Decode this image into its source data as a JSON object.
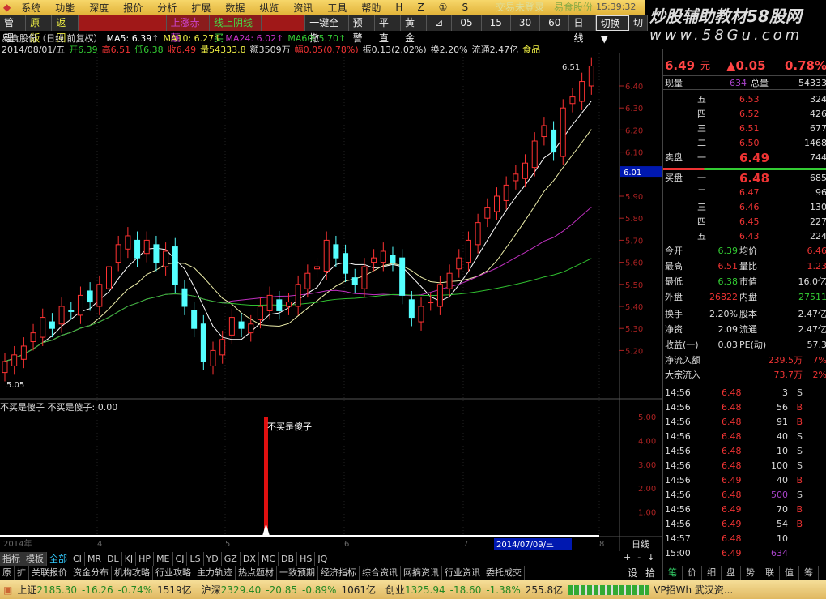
{
  "menu": [
    "系统",
    "功能",
    "深度",
    "报价",
    "分析",
    "扩展",
    "数据",
    "纵览",
    "资讯",
    "工具",
    "帮助",
    "H",
    "Z",
    "①",
    "S"
  ],
  "menu_right": {
    "trade": "交易未登录",
    "stock": "易食股份",
    "time": "15:39:32"
  },
  "watermark": {
    "line1": "炒股辅助教材58股网",
    "line2": "www.58Gu.com"
  },
  "toolbar": {
    "left": [
      "管理",
      "原版",
      "返回"
    ],
    "banners": [
      "上涨赤蘸",
      "线上阴线买"
    ],
    "right": [
      "一键全撤",
      "预警",
      "平直",
      "黄金",
      "⊿",
      "05",
      "15",
      "30",
      "60",
      "日线",
      "切换▼",
      "切"
    ]
  },
  "info1": {
    "title": "易食股份（日线 前复权）",
    "ma5": "MA5: 6.39↑",
    "ma10": "MA10: 6.27↑",
    "ma24": "MA24: 6.02↑",
    "ma60": "MA60: 5.70↑"
  },
  "info2": {
    "date": "2014/08/01/五",
    "open": "开6.39",
    "high": "高6.51",
    "low": "低6.38",
    "close": "收6.49",
    "vol": "量54333.8",
    "amt": "额3509万",
    "chg": "幅0.05(0.78%)",
    "amp": "振0.13(2.02%)",
    "turn": "换2.20%",
    "float": "流通2.47亿",
    "sector": "食品"
  },
  "chart_data": {
    "type": "candlestick",
    "ylim": [
      5.05,
      6.55
    ],
    "yticks": [
      "6.40",
      "6.30",
      "6.20",
      "6.10",
      "5.90",
      "5.80",
      "5.70",
      "5.60",
      "5.50",
      "5.40",
      "5.30",
      "5.20"
    ],
    "cursor_price": "6.01",
    "high_label": "6.51",
    "low_label": "5.05",
    "closes": [
      5.15,
      5.18,
      5.22,
      5.28,
      5.35,
      5.3,
      5.4,
      5.38,
      5.45,
      5.42,
      5.5,
      5.58,
      5.68,
      5.72,
      5.62,
      5.7,
      5.6,
      5.65,
      5.5,
      5.4,
      5.3,
      5.15,
      5.2,
      5.25,
      5.35,
      5.3,
      5.32,
      5.4,
      5.45,
      5.38,
      5.42,
      5.5,
      5.55,
      5.58,
      5.7,
      5.62,
      5.55,
      5.5,
      5.58,
      5.62,
      5.65,
      5.6,
      5.45,
      5.35,
      5.4,
      5.42,
      5.5,
      5.55,
      5.62,
      5.7,
      5.78,
      5.85,
      5.9,
      5.95,
      6.0,
      6.05,
      6.15,
      6.22,
      6.1,
      6.3,
      6.35,
      6.42,
      6.49
    ],
    "x_labels": [
      "2014年",
      "4",
      "5",
      "6",
      "7",
      "8"
    ],
    "cursor_date": "2014/07/09/三"
  },
  "indicator": {
    "name": "不买是傻子",
    "value_label": "不买是傻子: 0.00",
    "signal_label": "不买是傻子",
    "yticks": [
      "5.00",
      "4.00",
      "3.00",
      "2.00",
      "1.00"
    ],
    "ylim": [
      0,
      5
    ],
    "signal_value": 5
  },
  "period": "日线",
  "zoom_btns": [
    "+",
    "-",
    "↓"
  ],
  "quote": {
    "price": "6.49",
    "unit": "元",
    "change": "▲0.05",
    "pct": "0.78%",
    "xl_label": "现量",
    "xl": "634",
    "zl_label": "总量",
    "zl": "54333",
    "asks": [
      {
        "l": "五",
        "p": "6.53",
        "v": "324"
      },
      {
        "l": "四",
        "p": "6.52",
        "v": "426"
      },
      {
        "l": "三",
        "p": "6.51",
        "v": "677"
      },
      {
        "l": "二",
        "p": "6.50",
        "v": "1468"
      },
      {
        "l": "一",
        "p": "6.49",
        "v": "744"
      }
    ],
    "bids": [
      {
        "l": "一",
        "p": "6.48",
        "v": "685"
      },
      {
        "l": "二",
        "p": "6.47",
        "v": "96"
      },
      {
        "l": "三",
        "p": "6.46",
        "v": "130"
      },
      {
        "l": "四",
        "p": "6.45",
        "v": "227"
      },
      {
        "l": "五",
        "p": "6.43",
        "v": "224"
      }
    ],
    "sell_label": "卖盘",
    "buy_label": "买盘",
    "stats": [
      [
        "今开",
        "6.39",
        "均价",
        "6.46"
      ],
      [
        "最高",
        "6.51",
        "量比",
        "1.23"
      ],
      [
        "最低",
        "6.38",
        "市值",
        "16.0亿"
      ],
      [
        "外盘",
        "26822",
        "内盘",
        "27511"
      ],
      [
        "换手",
        "2.20%",
        "股本",
        "2.47亿"
      ],
      [
        "净资",
        "2.09",
        "流通",
        "2.47亿"
      ],
      [
        "收益(一)",
        "0.03",
        "PE(动)",
        "57.3"
      ]
    ],
    "flow": [
      [
        "净流入额",
        "239.5万",
        "7%"
      ],
      [
        "大宗流入",
        "73.7万",
        "2%"
      ]
    ],
    "ticks": [
      [
        "14:56",
        "6.48",
        "3",
        "S"
      ],
      [
        "14:56",
        "6.48",
        "56",
        "B"
      ],
      [
        "14:56",
        "6.48",
        "91",
        "B"
      ],
      [
        "14:56",
        "6.48",
        "40",
        "S"
      ],
      [
        "14:56",
        "6.48",
        "10",
        "S"
      ],
      [
        "14:56",
        "6.48",
        "100",
        "S"
      ],
      [
        "14:56",
        "6.49",
        "40",
        "B"
      ],
      [
        "14:56",
        "6.48",
        "500",
        "S"
      ],
      [
        "14:56",
        "6.49",
        "70",
        "B"
      ],
      [
        "14:56",
        "6.49",
        "54",
        "B"
      ],
      [
        "14:57",
        "6.48",
        "10",
        ""
      ],
      [
        "15:00",
        "6.49",
        "634",
        ""
      ]
    ],
    "bottom_tabs": [
      "笔",
      "价",
      "细",
      "盘",
      "势",
      "联",
      "值",
      "筹"
    ]
  },
  "tabs1": [
    "指标",
    "模板",
    "全部",
    "CI",
    "MR",
    "DL",
    "KJ",
    "HP",
    "ME",
    "CJ",
    "LS",
    "YD",
    "GZ",
    "DX",
    "MC",
    "DB",
    "HS",
    "JQ"
  ],
  "tabs2": [
    "原",
    "扩",
    "关联报价",
    "资金分布",
    "机构攻略",
    "行业攻略",
    "主力轨迹",
    "热点题材",
    "一致预期",
    "经济指标",
    "综合资讯",
    "网摘资讯",
    "行业资讯",
    "委托成交"
  ],
  "side_btns": [
    "设",
    "拾"
  ],
  "status": {
    "sh": "上证",
    "sh_v": "2185.30",
    "sh_c": "-16.26",
    "sh_p": "-0.74%",
    "sh_a": "1519亿",
    "hs": "沪深",
    "hs_v": "2329.40",
    "hs_c": "-20.85",
    "hs_p": "-0.89%",
    "hs_a": "1061亿",
    "cy": "创业",
    "cy_v": "1325.94",
    "cy_c": "-18.60",
    "cy_p": "-1.38%",
    "cy_a": "255.8亿",
    "news": "VP招Wh 武汉资..."
  }
}
